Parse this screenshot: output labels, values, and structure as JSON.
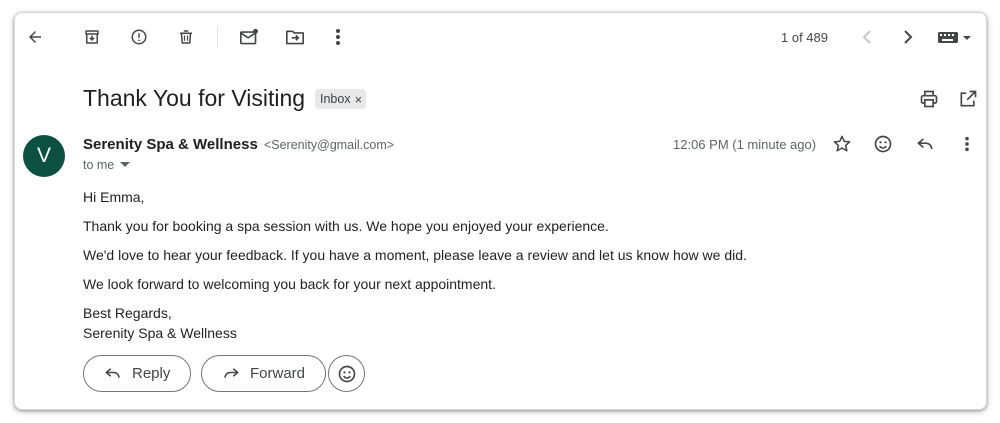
{
  "toolbar": {
    "pager_text": "1 of 489"
  },
  "email": {
    "subject": "Thank You for Visiting",
    "label": "Inbox",
    "label_remove": "×",
    "avatar_letter": "V",
    "avatar_color": "#0b5040",
    "sender_name": "Serenity Spa & Wellness",
    "sender_email": "<Serenity@gmail.com>",
    "recipient": "to me",
    "time": "12:06 PM (1 minute ago)",
    "body": {
      "greeting": "Hi Emma,",
      "line1": "Thank you for booking a spa session with us. We hope you enjoyed your experience.",
      "line2": "We'd love to hear your feedback. If you have a moment, please leave a review and let us know how we did.",
      "line3": "We look forward to welcoming you back for your next appointment.",
      "signoff": "Best Regards,",
      "signature": "Serenity Spa & Wellness"
    }
  },
  "actions": {
    "reply_label": "Reply",
    "forward_label": "Forward"
  }
}
